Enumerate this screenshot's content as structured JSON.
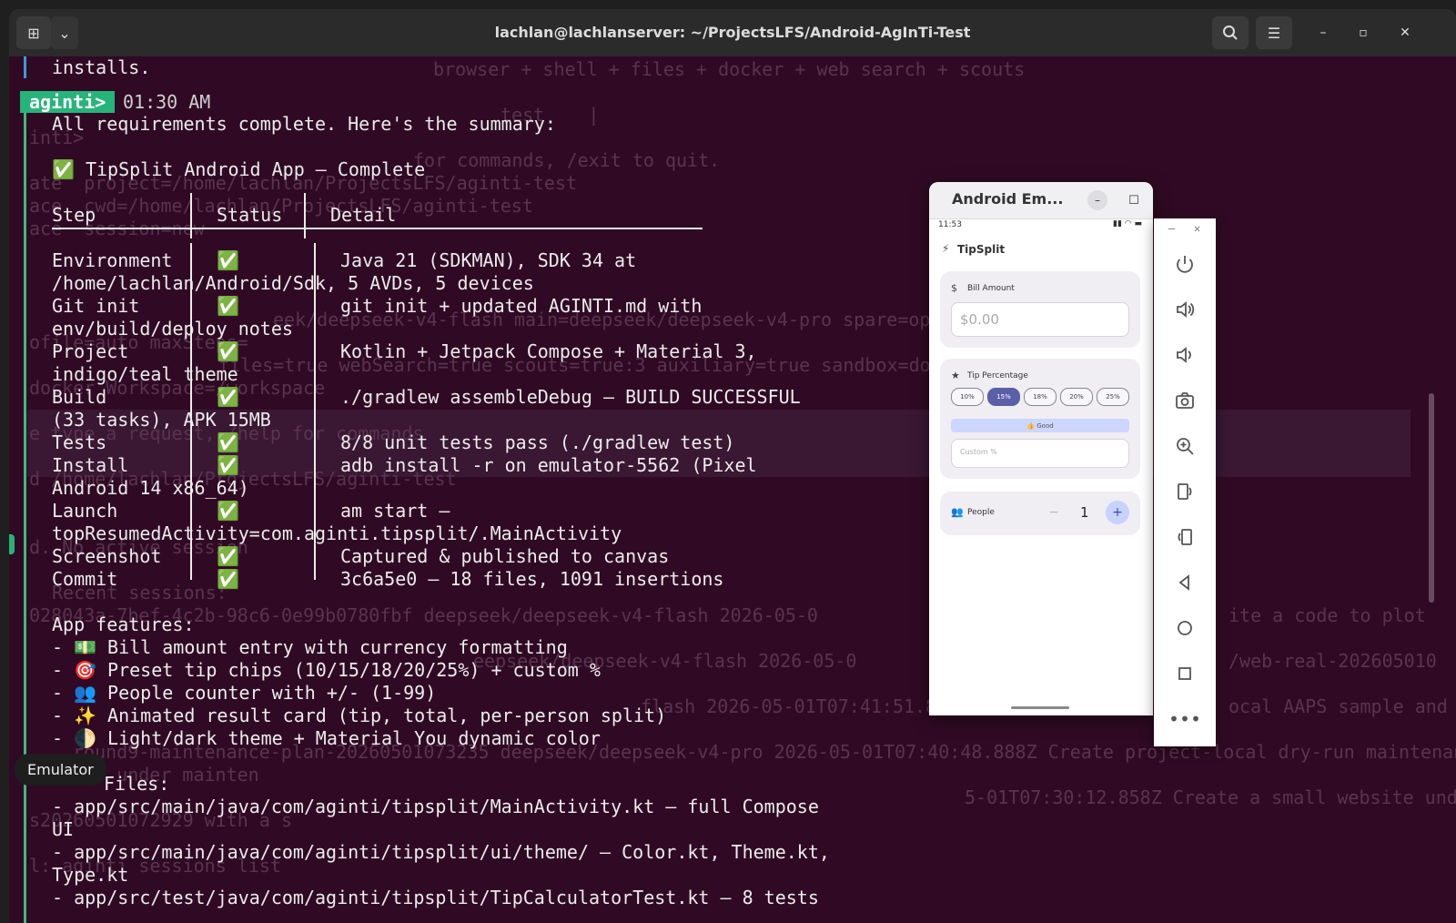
{
  "window": {
    "title": "lachlan@lachlanserver: ~/ProjectsLFS/Android-AgInTi-Test",
    "controls": [
      "–",
      "▫",
      "✕"
    ]
  },
  "terminal": {
    "prompt": "aginti>",
    "time": "01:30 AM",
    "top_line": "installs.",
    "lines": [
      "All requirements complete. Here's the summary:",
      "",
      "✅ TipSplit Android App — Complete"
    ],
    "table_header": {
      "step": "Step",
      "status": "Status",
      "detail": "Detail"
    },
    "rows": [
      {
        "step": "Environment",
        "status": "✅",
        "detail": "Java 21 (SDKMAN), SDK 34 at",
        "wrap": "/home/lachlan/Android/Sdk, 5 AVDs, 5 devices"
      },
      {
        "step": "Git init",
        "status": "✅",
        "detail": "git init + updated AGINTI.md with",
        "wrap": "env/build/deploy notes"
      },
      {
        "step": "Project",
        "status": "✅",
        "detail": "Kotlin + Jetpack Compose + Material 3,",
        "wrap": "indigo/teal theme"
      },
      {
        "step": "Build",
        "status": "✅",
        "detail": "./gradlew assembleDebug — BUILD SUCCESSFUL",
        "wrap": "(33 tasks), APK 15MB"
      },
      {
        "step": "Tests",
        "status": "✅",
        "detail": "8/8 unit tests pass (./gradlew test)",
        "wrap": ""
      },
      {
        "step": "Install",
        "status": "✅",
        "detail": "adb install -r on emulator-5562 (Pixel",
        "wrap": "Android 14 x86_64)"
      },
      {
        "step": "Launch",
        "status": "✅",
        "detail": "am start —",
        "wrap": "topResumedActivity=com.aginti.tipsplit/.MainActivity"
      },
      {
        "step": "Screenshot",
        "status": "✅",
        "detail": "Captured & published to canvas",
        "wrap": ""
      },
      {
        "step": "Commit",
        "status": "✅",
        "detail": "3c6a5e0 — 18 files, 1091 insertions",
        "wrap": ""
      }
    ],
    "features_title": "App features:",
    "features": [
      "- 💵 Bill amount entry with currency formatting",
      "- 🎯 Preset tip chips (10/15/18/20/25%) + custom %",
      "- 👥 People counter with +/- (1-99)",
      "- ✨ Animated result card (tip, total, per-person split)",
      "- 🌓 Light/dark theme + Material You dynamic color"
    ],
    "files_title": "Files:",
    "files": [
      "- app/src/main/java/com/aginti/tipsplit/MainActivity.kt — full Compose",
      "UI",
      "- app/src/main/java/com/aginti/tipsplit/ui/theme/ — Color.kt, Theme.kt,",
      "Type.kt",
      "- app/src/test/java/com/aginti/tipsplit/TipCalculatorTest.kt — 8 tests"
    ],
    "ghost": [
      "browser + shell + files + docker + web search + scouts",
      "test    | ",
      "inti>",
      "for commands, /exit to quit.",
      "ate  project=/home/lachlan/ProjectsLFS/aginti-test",
      "ace  cwd=/home/lachlan/ProjectsLFS/aginti-test",
      "ace  session=new",
      "eek/deepseek-v4-flash main=deepseek/deepseek-v4-pro spare=opena",
      "ofile=auto maxSteps=",
      "files=true webSearch=true scouts=true:3 auxiliary=true sandbox=docker",
      "docker Workspace=/workspace",
      "e type a request, /help for commands",
      "d /home/lachlan/ProjectsLFS/aginti-test",
      "d. No active session",
      "Recent sessions:",
      "028043a-7bef-4c2b-98c6-0e99b0780fbf deepseek/deepseek-v4-flash 2026-05-0",
      "ite a code to plot",
      "eepseek/deepseek-v4-flash 2026-05-0",
      "/web-real-202605010",
      "flash 2026-05-01T07:41:51.84",
      "ocal AAPS sample and",
      "round9-maintenance-plan-20260501073235 deepseek/deepseek-v4-pro 2026-05-01T07:40:48.888Z Create project-local dry-run maintenance",
      "pts under mainten",
      "5-01T07:30:12.858Z Create a small website under round9/website",
      "s20260501072929 with a s",
      "l: aginti sessions list"
    ]
  },
  "tooltip": "Emulator",
  "emulator": {
    "title": "Android Em...",
    "status_time": "11:53",
    "app_name": "TipSplit",
    "bill_label": "Bill Amount",
    "bill_placeholder": "$0.00",
    "tip_label": "Tip Percentage",
    "chips": [
      "10%",
      "15%",
      "18%",
      "20%",
      "25%"
    ],
    "selected_chip": "15%",
    "good_label": "👍 Good",
    "custom_placeholder": "Custom %",
    "people_label": "People",
    "people_count": "1"
  },
  "side_toolbar": [
    "power",
    "volume-up",
    "volume-down",
    "camera",
    "zoom",
    "rotate-left",
    "rotate-right",
    "back",
    "home",
    "overview",
    "more"
  ]
}
